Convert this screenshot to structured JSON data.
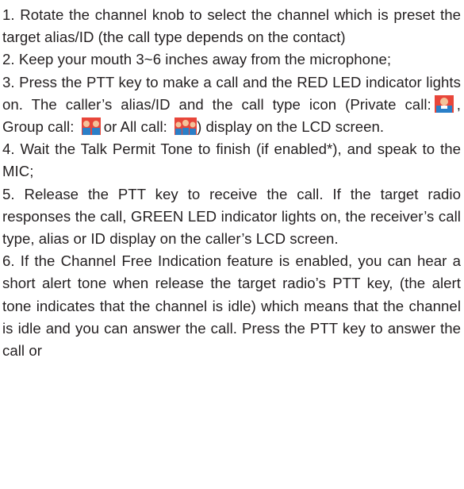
{
  "paragraphs": {
    "p1": "1. Rotate the channel knob to select the channel which is preset the target alias/ID (the call type depends on the contact)",
    "p2": "2. Keep your mouth 3~6 inches away from the microphone;",
    "p3_a": "3. Press the PTT key to make a call and the RED LED indicator lights on. The caller’s alias/ID and the call type icon (Private call:",
    "p3_b": ", Group call:",
    "p3_c": "or All call:",
    "p3_d": ") display on the LCD screen.",
    "p4": "4. Wait the Talk Permit Tone to finish (if enabled*), and speak to the MIC;",
    "p5": "5. Release the PTT key to receive the call. If the target radio responses the call, GREEN LED indicator lights on, the receiver’s call type, alias or ID display on the caller’s LCD screen.",
    "p6": "6. If the Channel Free Indication feature is enabled, you can hear a short alert tone when release the target radio’s PTT key, (the alert tone indicates that the channel is idle) which means that the channel is idle and you can answer the call. Press the PTT key to answer the call or"
  },
  "icons": {
    "private_call": "private-call-icon",
    "group_call": "group-call-icon",
    "all_call": "all-call-icon"
  },
  "colors": {
    "text": "#231f20",
    "icon_red": "#e8463a",
    "icon_blue": "#2a7fc8",
    "icon_skin": "#f3c39a"
  }
}
